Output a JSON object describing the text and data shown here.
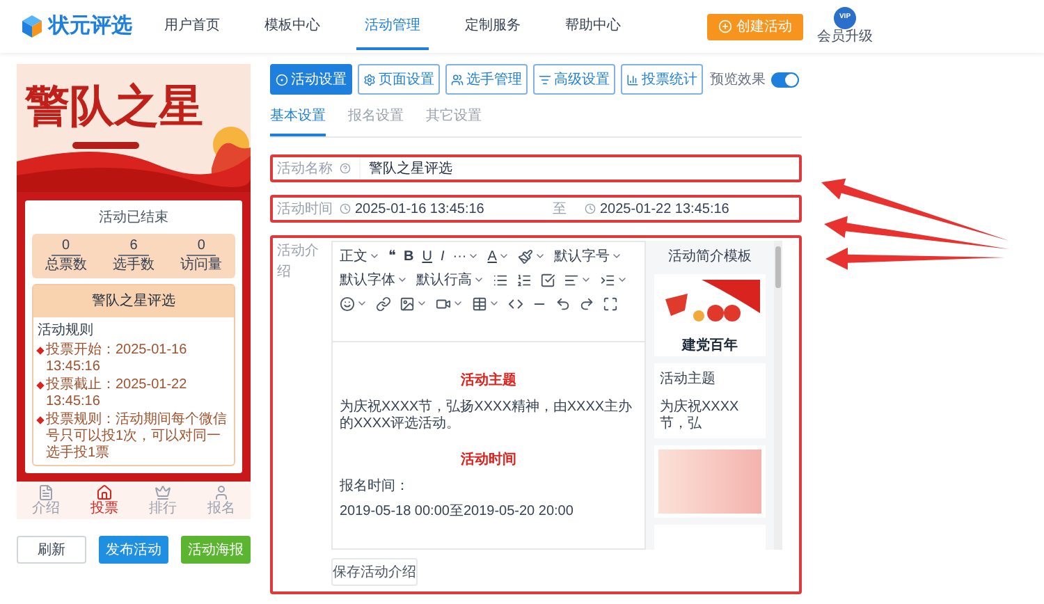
{
  "header": {
    "logo": "状元评选",
    "nav": [
      {
        "label": "用户首页",
        "selected": false
      },
      {
        "label": "模板中心",
        "selected": false
      },
      {
        "label": "活动管理",
        "selected": true
      },
      {
        "label": "定制服务",
        "selected": false
      },
      {
        "label": "帮助中心",
        "selected": false
      }
    ],
    "create_button": "创建活动",
    "vip_badge": "VIP",
    "vip_label": "会员升级"
  },
  "preview": {
    "banner_title": "警队之星",
    "status": "活动已结束",
    "stats": [
      {
        "value": "0",
        "label": "总票数"
      },
      {
        "value": "6",
        "label": "选手数"
      },
      {
        "value": "0",
        "label": "访问量"
      }
    ],
    "title": "警队之星评选",
    "rules_heading": "活动规则",
    "rules": [
      {
        "label": "投票开始：",
        "value": "2025-01-16 13:45:16"
      },
      {
        "label": "投票截止：",
        "value": "2025-01-22 13:45:16"
      },
      {
        "label": "投票规则：",
        "value": "活动期间每个微信号只可以投1次，可以对同一选手投1票"
      }
    ],
    "bottom_nav": [
      {
        "label": "介绍",
        "selected": false
      },
      {
        "label": "投票",
        "selected": true
      },
      {
        "label": "排行",
        "selected": false
      },
      {
        "label": "报名",
        "selected": false
      }
    ]
  },
  "actions": [
    {
      "label": "刷新",
      "kind": "default"
    },
    {
      "label": "发布活动",
      "kind": "primary"
    },
    {
      "label": "活动海报",
      "kind": "success"
    }
  ],
  "settings_tabs": [
    {
      "label": "活动设置",
      "selected": true
    },
    {
      "label": "页面设置",
      "selected": false
    },
    {
      "label": "选手管理",
      "selected": false
    },
    {
      "label": "高级设置",
      "selected": false
    },
    {
      "label": "投票统计",
      "selected": false
    }
  ],
  "preview_toggle": {
    "label": "预览效果",
    "on": true
  },
  "sub_tabs": [
    {
      "label": "基本设置",
      "selected": true
    },
    {
      "label": "报名设置",
      "selected": false
    },
    {
      "label": "其它设置",
      "selected": false
    }
  ],
  "form": {
    "name": {
      "label": "活动名称",
      "value": "警队之星评选"
    },
    "time": {
      "label": "活动时间",
      "start": "2025-01-16 13:45:16",
      "separator": "至",
      "end": "2025-01-22 13:45:16"
    },
    "intro": {
      "label": "活动介绍",
      "toolbar_labels": [
        "正文",
        "❝",
        "B",
        "U",
        "I",
        "···",
        "A",
        "默认字号",
        "默认字体",
        "默认行高"
      ],
      "content": [
        {
          "kind": "heading",
          "text": "活动主题"
        },
        {
          "kind": "paragraph",
          "text": "为庆祝XXXX节，弘扬XXXX精神，由XXXX主办的XXXX评选活动。"
        },
        {
          "kind": "heading",
          "text": "活动时间"
        },
        {
          "kind": "paragraph",
          "text": "报名时间："
        },
        {
          "kind": "paragraph",
          "text": "2019-05-18 00:00至2019-05-20 20:00"
        }
      ],
      "templates_title": "活动简介模板",
      "templates": [
        {
          "kind": "banner",
          "caption": "建党百年"
        },
        {
          "kind": "text",
          "title": "活动主题",
          "excerpt": "为庆祝XXXX节，弘"
        },
        {
          "kind": "pattern"
        },
        {
          "kind": "blank"
        }
      ],
      "save_button": "保存活动介绍"
    }
  }
}
